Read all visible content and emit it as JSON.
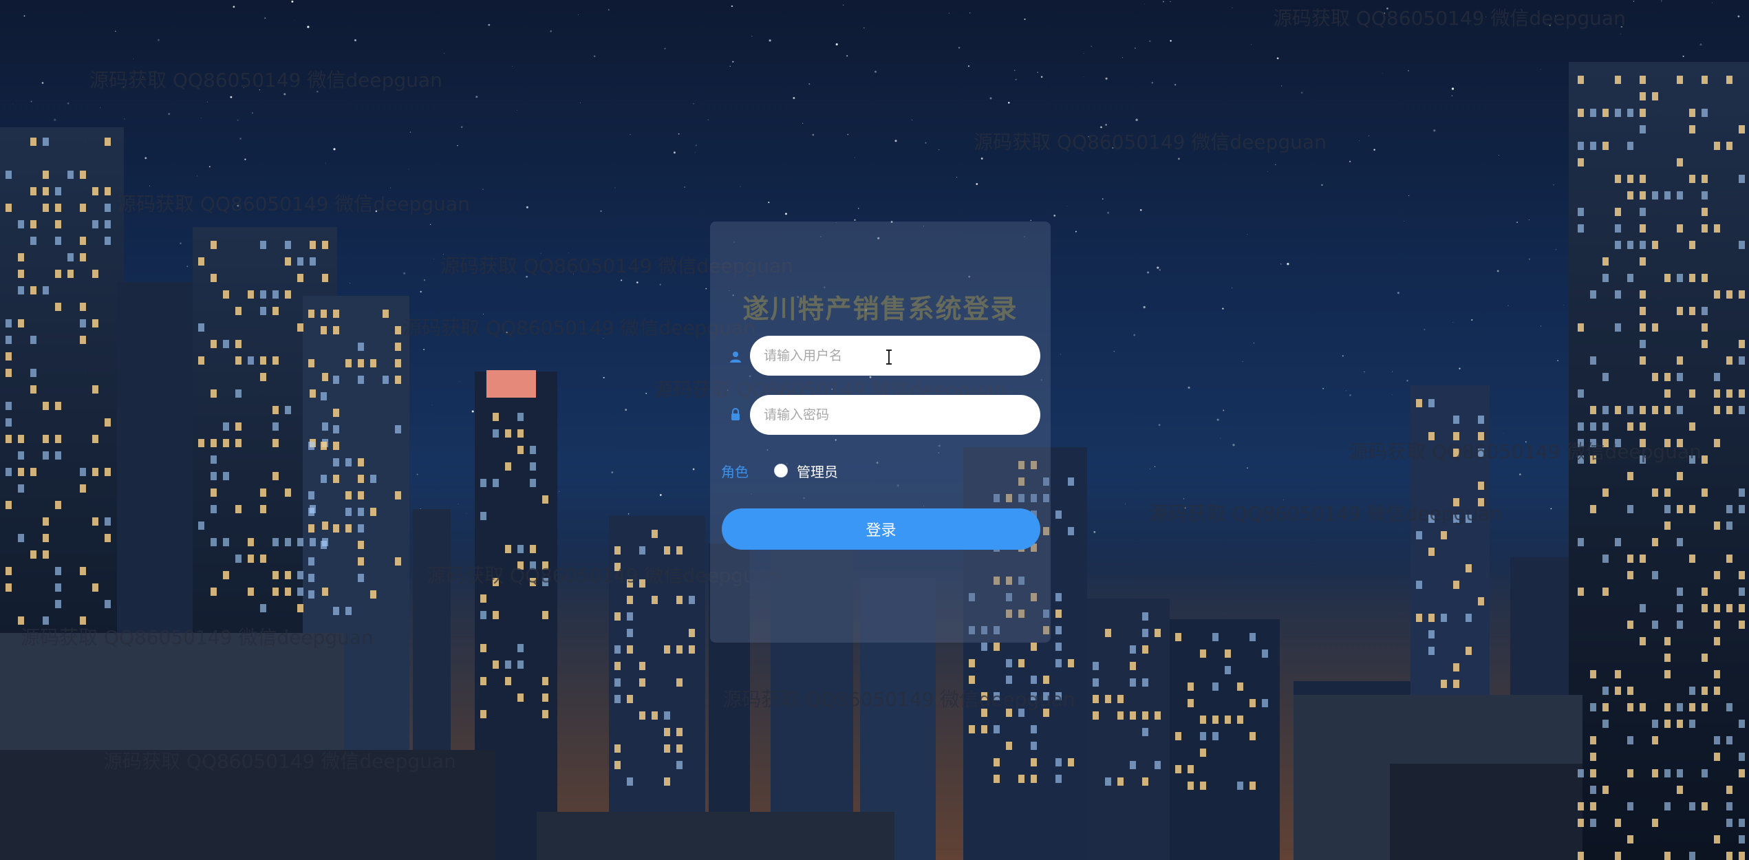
{
  "login": {
    "title": "遂川特产销售系统登录",
    "username_placeholder": "请输入用户名",
    "password_placeholder": "请输入密码",
    "role_label": "角色",
    "role_option": "管理员",
    "submit_label": "登录"
  },
  "watermark_text": "源码获取 QQ86050149 微信deepguan",
  "colors": {
    "accent": "#3a97f5",
    "role_label": "#3e8fe6"
  },
  "icons": {
    "username": "user-icon",
    "password": "lock-icon"
  }
}
